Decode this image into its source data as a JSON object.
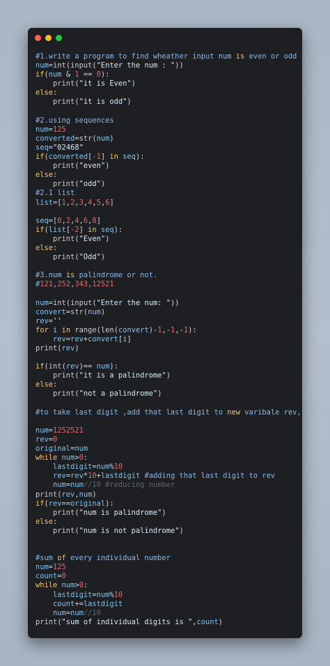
{
  "window": {
    "buttons": [
      "close",
      "minimize",
      "zoom"
    ]
  },
  "code_lines": [
    [
      [
        "c",
        "#1.write a program to find wheather input "
      ],
      [
        "v",
        "num"
      ],
      [
        "c",
        " "
      ],
      [
        "k",
        "is"
      ],
      [
        "c",
        " even or odd"
      ]
    ],
    [
      [
        "v",
        "num"
      ],
      [
        "p",
        "="
      ],
      [
        "f",
        "int"
      ],
      [
        "p",
        "("
      ],
      [
        "f",
        "input"
      ],
      [
        "p",
        "("
      ],
      [
        "s",
        "\"Enter the num : \""
      ],
      [
        "p",
        "))"
      ]
    ],
    [
      [
        "k",
        "if"
      ],
      [
        "p",
        "("
      ],
      [
        "v",
        "num"
      ],
      [
        "p",
        " & "
      ],
      [
        "n",
        "1"
      ],
      [
        "p",
        " == "
      ],
      [
        "n",
        "0"
      ],
      [
        "p",
        "):"
      ]
    ],
    [
      [
        "p",
        "    "
      ],
      [
        "f",
        "print"
      ],
      [
        "p",
        "("
      ],
      [
        "s",
        "\"it is Even\""
      ],
      [
        "p",
        ")"
      ]
    ],
    [
      [
        "k",
        "else"
      ],
      [
        "p",
        ":"
      ]
    ],
    [
      [
        "p",
        "    "
      ],
      [
        "f",
        "print"
      ],
      [
        "p",
        "("
      ],
      [
        "s",
        "\"it is odd\""
      ],
      [
        "p",
        ")"
      ]
    ],
    [],
    [
      [
        "c",
        "#2.using sequences"
      ]
    ],
    [
      [
        "v",
        "num"
      ],
      [
        "p",
        "="
      ],
      [
        "n",
        "125"
      ]
    ],
    [
      [
        "v",
        "converted"
      ],
      [
        "p",
        "="
      ],
      [
        "f",
        "str"
      ],
      [
        "p",
        "("
      ],
      [
        "v",
        "num"
      ],
      [
        "p",
        ")"
      ]
    ],
    [
      [
        "v",
        "seq"
      ],
      [
        "p",
        "="
      ],
      [
        "s",
        "\"02468\""
      ]
    ],
    [
      [
        "k",
        "if"
      ],
      [
        "p",
        "("
      ],
      [
        "v",
        "converted"
      ],
      [
        "p",
        "["
      ],
      [
        "n",
        "-1"
      ],
      [
        "p",
        "] "
      ],
      [
        "k",
        "in"
      ],
      [
        "p",
        " "
      ],
      [
        "v",
        "seq"
      ],
      [
        "p",
        "):"
      ]
    ],
    [
      [
        "p",
        "    "
      ],
      [
        "f",
        "print"
      ],
      [
        "p",
        "("
      ],
      [
        "s",
        "\"even\""
      ],
      [
        "p",
        ")"
      ]
    ],
    [
      [
        "k",
        "else"
      ],
      [
        "p",
        ":"
      ]
    ],
    [
      [
        "p",
        "    "
      ],
      [
        "f",
        "print"
      ],
      [
        "p",
        "("
      ],
      [
        "s",
        "\"odd\""
      ],
      [
        "p",
        ")"
      ]
    ],
    [
      [
        "c",
        "#2.1 list"
      ]
    ],
    [
      [
        "v",
        "list"
      ],
      [
        "p",
        "=["
      ],
      [
        "n",
        "1"
      ],
      [
        "p",
        ","
      ],
      [
        "n",
        "2"
      ],
      [
        "p",
        ","
      ],
      [
        "n",
        "3"
      ],
      [
        "p",
        ","
      ],
      [
        "n",
        "4"
      ],
      [
        "p",
        ","
      ],
      [
        "n",
        "5"
      ],
      [
        "p",
        ","
      ],
      [
        "n",
        "6"
      ],
      [
        "p",
        "]"
      ]
    ],
    [],
    [
      [
        "v",
        "seq"
      ],
      [
        "p",
        "=["
      ],
      [
        "n",
        "0"
      ],
      [
        "p",
        ","
      ],
      [
        "n",
        "2"
      ],
      [
        "p",
        ","
      ],
      [
        "n",
        "4"
      ],
      [
        "p",
        ","
      ],
      [
        "n",
        "6"
      ],
      [
        "p",
        ","
      ],
      [
        "n",
        "8"
      ],
      [
        "p",
        "]"
      ]
    ],
    [
      [
        "k",
        "if"
      ],
      [
        "p",
        "("
      ],
      [
        "v",
        "list"
      ],
      [
        "p",
        "["
      ],
      [
        "n",
        "-2"
      ],
      [
        "p",
        "] "
      ],
      [
        "k",
        "in"
      ],
      [
        "p",
        " "
      ],
      [
        "v",
        "seq"
      ],
      [
        "p",
        "):"
      ]
    ],
    [
      [
        "p",
        "    "
      ],
      [
        "f",
        "print"
      ],
      [
        "p",
        "("
      ],
      [
        "s",
        "\"Even\""
      ],
      [
        "p",
        ")"
      ]
    ],
    [
      [
        "k",
        "else"
      ],
      [
        "p",
        ":"
      ]
    ],
    [
      [
        "p",
        "    "
      ],
      [
        "f",
        "print"
      ],
      [
        "p",
        "("
      ],
      [
        "s",
        "\"Odd\""
      ],
      [
        "p",
        ")"
      ]
    ],
    [],
    [
      [
        "c",
        "#3."
      ],
      [
        "v",
        "num"
      ],
      [
        "c",
        " "
      ],
      [
        "k",
        "is"
      ],
      [
        "c",
        " palindrome or not."
      ]
    ],
    [
      [
        "c",
        "#"
      ],
      [
        "n",
        "121"
      ],
      [
        "c",
        ","
      ],
      [
        "n",
        "252"
      ],
      [
        "c",
        ","
      ],
      [
        "n",
        "343"
      ],
      [
        "c",
        ","
      ],
      [
        "n",
        "12521"
      ]
    ],
    [],
    [
      [
        "v",
        "num"
      ],
      [
        "p",
        "="
      ],
      [
        "f",
        "int"
      ],
      [
        "p",
        "("
      ],
      [
        "f",
        "input"
      ],
      [
        "p",
        "("
      ],
      [
        "s",
        "\"Enter the num: \""
      ],
      [
        "p",
        "))"
      ]
    ],
    [
      [
        "v",
        "convert"
      ],
      [
        "p",
        "="
      ],
      [
        "f",
        "str"
      ],
      [
        "p",
        "("
      ],
      [
        "v",
        "num"
      ],
      [
        "p",
        ")"
      ]
    ],
    [
      [
        "v",
        "rev"
      ],
      [
        "p",
        "="
      ],
      [
        "s",
        "''"
      ]
    ],
    [
      [
        "k",
        "for"
      ],
      [
        "p",
        " "
      ],
      [
        "v",
        "i"
      ],
      [
        "p",
        " "
      ],
      [
        "k",
        "in"
      ],
      [
        "p",
        " "
      ],
      [
        "f",
        "range"
      ],
      [
        "p",
        "("
      ],
      [
        "f",
        "len"
      ],
      [
        "p",
        "("
      ],
      [
        "v",
        "convert"
      ],
      [
        "p",
        ")-"
      ],
      [
        "n",
        "1"
      ],
      [
        "p",
        ",-"
      ],
      [
        "n",
        "1"
      ],
      [
        "p",
        ",-"
      ],
      [
        "n",
        "1"
      ],
      [
        "p",
        "):"
      ]
    ],
    [
      [
        "p",
        "    "
      ],
      [
        "v",
        "rev"
      ],
      [
        "p",
        "="
      ],
      [
        "v",
        "rev"
      ],
      [
        "p",
        "+"
      ],
      [
        "v",
        "convert"
      ],
      [
        "p",
        "["
      ],
      [
        "v",
        "i"
      ],
      [
        "p",
        "]"
      ]
    ],
    [
      [
        "f",
        "print"
      ],
      [
        "p",
        "("
      ],
      [
        "v",
        "rev"
      ],
      [
        "p",
        ")"
      ]
    ],
    [],
    [
      [
        "k",
        "if"
      ],
      [
        "p",
        "("
      ],
      [
        "f",
        "int"
      ],
      [
        "p",
        "("
      ],
      [
        "v",
        "rev"
      ],
      [
        "p",
        ")== "
      ],
      [
        "v",
        "num"
      ],
      [
        "p",
        "):"
      ]
    ],
    [
      [
        "p",
        "    "
      ],
      [
        "f",
        "print"
      ],
      [
        "p",
        "("
      ],
      [
        "s",
        "\"it is a palindrome\""
      ],
      [
        "p",
        ")"
      ]
    ],
    [
      [
        "k",
        "else"
      ],
      [
        "p",
        ":"
      ]
    ],
    [
      [
        "p",
        "    "
      ],
      [
        "f",
        "print"
      ],
      [
        "p",
        "("
      ],
      [
        "s",
        "\"not a palindrome\""
      ],
      [
        "p",
        ")"
      ]
    ],
    [],
    [
      [
        "c",
        "#to take last digit ,add that last digit to "
      ],
      [
        "k",
        "new"
      ],
      [
        "c",
        " varibale rev,"
      ]
    ],
    [],
    [
      [
        "v",
        "num"
      ],
      [
        "p",
        "="
      ],
      [
        "n",
        "1252521"
      ]
    ],
    [
      [
        "v",
        "rev"
      ],
      [
        "p",
        "="
      ],
      [
        "n",
        "0"
      ]
    ],
    [
      [
        "v",
        "original"
      ],
      [
        "p",
        "="
      ],
      [
        "v",
        "num"
      ]
    ],
    [
      [
        "k",
        "while"
      ],
      [
        "p",
        " "
      ],
      [
        "v",
        "num"
      ],
      [
        "p",
        ">"
      ],
      [
        "n",
        "0"
      ],
      [
        "p",
        ":"
      ]
    ],
    [
      [
        "p",
        "    "
      ],
      [
        "v",
        "lastdigit"
      ],
      [
        "p",
        "="
      ],
      [
        "v",
        "num"
      ],
      [
        "p",
        "%"
      ],
      [
        "n",
        "10"
      ]
    ],
    [
      [
        "p",
        "    "
      ],
      [
        "v",
        "rev"
      ],
      [
        "p",
        "="
      ],
      [
        "v",
        "rev"
      ],
      [
        "p",
        "*"
      ],
      [
        "n",
        "10"
      ],
      [
        "p",
        "+"
      ],
      [
        "v",
        "lastdigit"
      ],
      [
        "c",
        " #adding that last digit to rev"
      ]
    ],
    [
      [
        "p",
        "    "
      ],
      [
        "v",
        "num"
      ],
      [
        "p",
        "="
      ],
      [
        "v",
        "num"
      ],
      [
        "d",
        "//10 #reducing number"
      ]
    ],
    [
      [
        "f",
        "print"
      ],
      [
        "p",
        "("
      ],
      [
        "v",
        "rev"
      ],
      [
        "p",
        ","
      ],
      [
        "v",
        "num"
      ],
      [
        "p",
        ")"
      ]
    ],
    [
      [
        "k",
        "if"
      ],
      [
        "p",
        "("
      ],
      [
        "v",
        "rev"
      ],
      [
        "p",
        "=="
      ],
      [
        "v",
        "original"
      ],
      [
        "p",
        "):"
      ]
    ],
    [
      [
        "p",
        "    "
      ],
      [
        "f",
        "print"
      ],
      [
        "p",
        "("
      ],
      [
        "s",
        "\"num is palindrome\""
      ],
      [
        "p",
        ")"
      ]
    ],
    [
      [
        "k",
        "else"
      ],
      [
        "p",
        ":"
      ]
    ],
    [
      [
        "p",
        "    "
      ],
      [
        "f",
        "print"
      ],
      [
        "p",
        "("
      ],
      [
        "s",
        "\"num is not palindrome\""
      ],
      [
        "p",
        ")"
      ]
    ],
    [],
    [],
    [
      [
        "c",
        "#sum "
      ],
      [
        "k",
        "of"
      ],
      [
        "c",
        " every individual number"
      ]
    ],
    [
      [
        "v",
        "num"
      ],
      [
        "p",
        "="
      ],
      [
        "n",
        "125"
      ]
    ],
    [
      [
        "v",
        "count"
      ],
      [
        "p",
        "="
      ],
      [
        "n",
        "0"
      ]
    ],
    [
      [
        "k",
        "while"
      ],
      [
        "p",
        " "
      ],
      [
        "v",
        "num"
      ],
      [
        "p",
        ">"
      ],
      [
        "n",
        "0"
      ],
      [
        "p",
        ":"
      ]
    ],
    [
      [
        "p",
        "    "
      ],
      [
        "v",
        "lastdigit"
      ],
      [
        "p",
        "="
      ],
      [
        "v",
        "num"
      ],
      [
        "p",
        "%"
      ],
      [
        "n",
        "10"
      ]
    ],
    [
      [
        "p",
        "    "
      ],
      [
        "v",
        "count"
      ],
      [
        "p",
        "+="
      ],
      [
        "v",
        "lastdigit"
      ]
    ],
    [
      [
        "p",
        "    "
      ],
      [
        "v",
        "num"
      ],
      [
        "p",
        "="
      ],
      [
        "v",
        "num"
      ],
      [
        "d",
        "//10"
      ]
    ],
    [
      [
        "f",
        "print"
      ],
      [
        "p",
        "("
      ],
      [
        "s",
        "\"sum of individual digits is \""
      ],
      [
        "p",
        ","
      ],
      [
        "v",
        "count"
      ],
      [
        "p",
        ")"
      ]
    ]
  ]
}
